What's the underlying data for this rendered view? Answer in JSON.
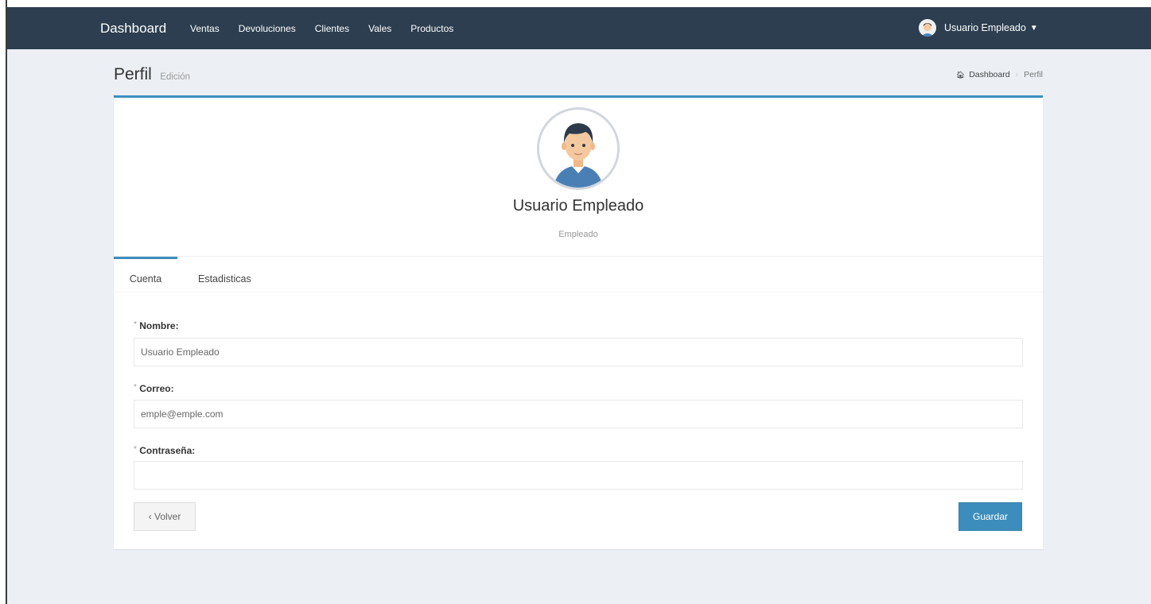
{
  "navbar": {
    "brand": "Dashboard",
    "links": [
      "Ventas",
      "Devoluciones",
      "Clientes",
      "Vales",
      "Productos"
    ],
    "user": "Usuario Empleado"
  },
  "header": {
    "title": "Perfil",
    "subtitle": "Edición",
    "breadcrumb": [
      "Dashboard",
      "Perfil"
    ]
  },
  "profile": {
    "name": "Usuario Empleado",
    "role": "Empleado"
  },
  "tabs": [
    "Cuenta",
    "Estadisticas"
  ],
  "form": {
    "nombre_label": "Nombre:",
    "nombre_value": "Usuario Empleado",
    "correo_label": "Correo:",
    "correo_value": "emple@emple.com",
    "pass_label": "Contraseña:",
    "pass_value": "",
    "required_mark": "*",
    "back_label": "‹ Volver",
    "save_label": "Guardar"
  },
  "colors": {
    "navbar": "#2c3e50",
    "accent": "#3c8dbc",
    "background": "#ecf0f5"
  }
}
